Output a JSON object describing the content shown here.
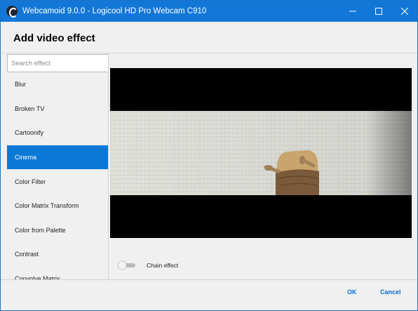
{
  "window": {
    "title": "Webcamoid 9.0.0 - Logicool HD Pro Webcam C910"
  },
  "dialog": {
    "heading": "Add video effect"
  },
  "search": {
    "placeholder": "Search effect",
    "value": ""
  },
  "effects": [
    {
      "label": "Blur",
      "selected": false
    },
    {
      "label": "Broken TV",
      "selected": false
    },
    {
      "label": "Cartoonify",
      "selected": false
    },
    {
      "label": "Cinema",
      "selected": true
    },
    {
      "label": "Color Filter",
      "selected": false
    },
    {
      "label": "Color Matrix Transform",
      "selected": false
    },
    {
      "label": "Color from Palette",
      "selected": false
    },
    {
      "label": "Contrast",
      "selected": false
    },
    {
      "label": "Convolve Matrix",
      "selected": false
    }
  ],
  "chain": {
    "label": "Chain effect",
    "enabled": false
  },
  "buttons": {
    "ok": "OK",
    "cancel": "Cancel"
  },
  "colors": {
    "titlebar": "#1277d6",
    "selection": "#0a78d4",
    "accent_text": "#0a6fd0"
  },
  "icons": {
    "app": "webcamoid-icon",
    "minimize": "minimize-icon",
    "maximize": "maximize-icon",
    "close": "close-icon"
  }
}
